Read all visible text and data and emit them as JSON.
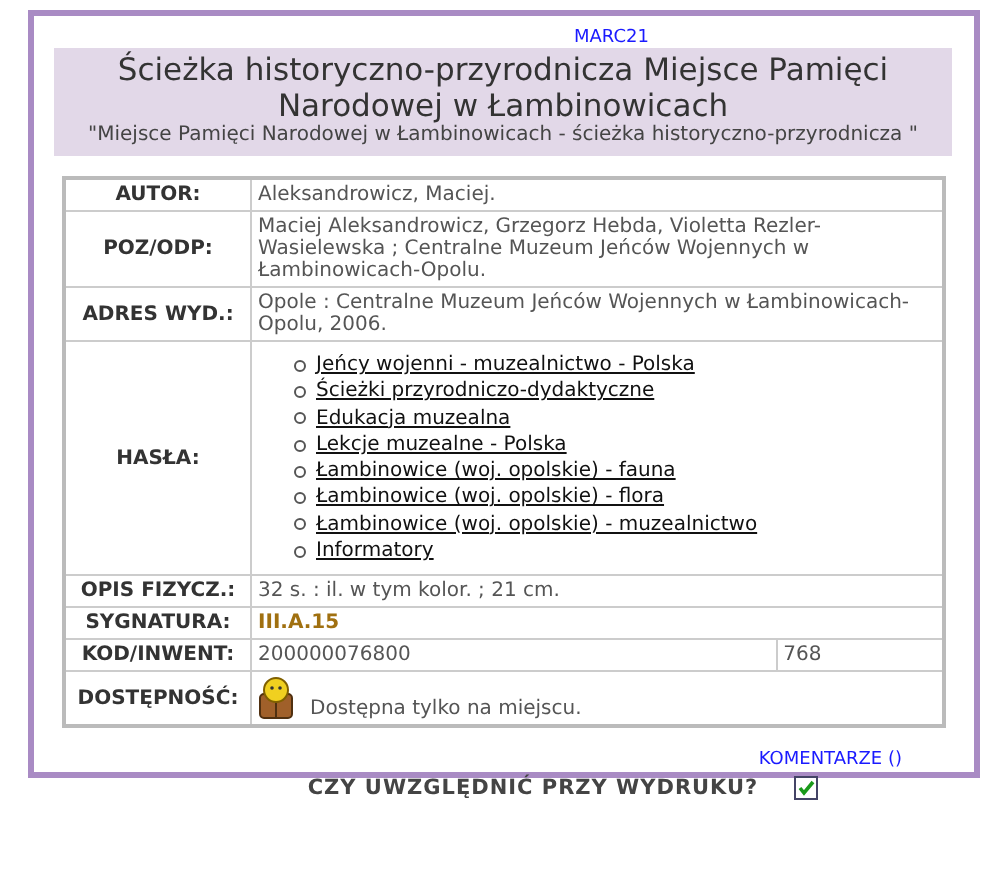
{
  "marc_link": "MARC21",
  "header": {
    "title": "Ścieżka historyczno-przyrodnicza Miejsce Pamięci Narodowej w Łambinowicach",
    "subtitle": "\"Miejsce Pamięci Narodowej w Łambinowicach - ścieżka historyczno-przyrodnicza \""
  },
  "rows": [
    {
      "kind": "text",
      "label": "AUTOR:",
      "value": "Aleksandrowicz, Maciej."
    },
    {
      "kind": "text",
      "label": "POZ/ODP:",
      "value": "Maciej Aleksandrowicz, Grzegorz Hebda, Violetta Rezler-Wasielewska ; Centralne Muzeum Jeńców Wojennych w Łambinowicach-Opolu."
    },
    {
      "kind": "text",
      "label": "ADRES WYD.:",
      "value": "Opole : Centralne Muzeum Jeńców Wojennych w Łambinowicach-Opolu, 2006."
    },
    {
      "kind": "list",
      "label": "HASŁA:",
      "items": [
        "Jeńcy wojenni - muzealnictwo - Polska",
        "Ścieżki przyrodniczo-dydaktyczne",
        "Edukacja muzealna",
        "Lekcje muzealne - Polska",
        "Łambinowice (woj. opolskie) - fauna",
        "Łambinowice (woj. opolskie) - flora",
        "Łambinowice (woj. opolskie) - muzealnictwo",
        "Informatory"
      ]
    },
    {
      "kind": "text",
      "label": "OPIS FIZYCZ.:",
      "value": "32 s. : il. w tym kolor. ; 21 cm."
    },
    {
      "kind": "code",
      "label": "SYGNATURA:",
      "value": "III.A.15"
    },
    {
      "kind": "split",
      "label": "KOD/INWENT:",
      "values": [
        "200000076800",
        "768"
      ]
    },
    {
      "kind": "availability",
      "label": "DOSTĘPNOŚĆ:",
      "value": "Dostępna tylko na miejscu."
    }
  ],
  "comments_link": "KOMENTARZE ()",
  "print_option": {
    "label": "CZY UWZGLĘDNIĆ PRZY WYDRUKU?",
    "checked": true
  }
}
